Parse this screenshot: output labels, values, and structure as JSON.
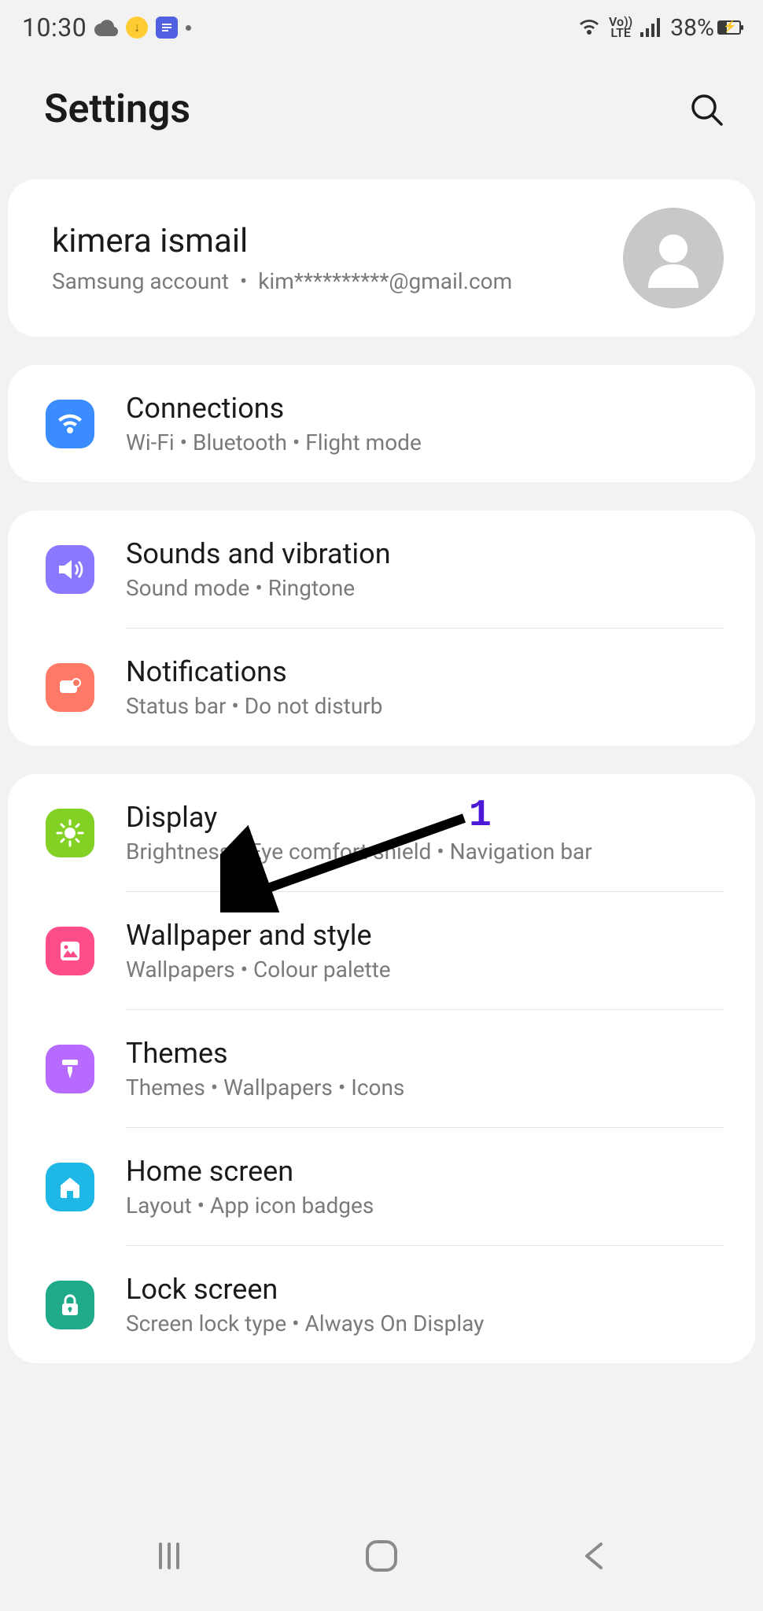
{
  "status": {
    "time": "10:30",
    "battery_percent": "38%",
    "volte": "Vo))\nLTE"
  },
  "header": {
    "title": "Settings"
  },
  "account": {
    "name": "kimera ismail",
    "provider": "Samsung account",
    "email": "kim**********@gmail.com"
  },
  "groups": [
    {
      "items": [
        {
          "icon": "wifi",
          "color": "ic-blue",
          "title": "Connections",
          "sub": "Wi-Fi  •  Bluetooth  •  Flight mode"
        }
      ]
    },
    {
      "items": [
        {
          "icon": "sound",
          "color": "ic-purple",
          "title": "Sounds and vibration",
          "sub": "Sound mode  •  Ringtone"
        },
        {
          "icon": "notif",
          "color": "ic-coral",
          "title": "Notifications",
          "sub": "Status bar  •  Do not disturb"
        }
      ]
    },
    {
      "items": [
        {
          "icon": "sun",
          "color": "ic-green",
          "title": "Display",
          "sub": "Brightness  •  Eye comfort shield  •  Navigation bar"
        },
        {
          "icon": "picture",
          "color": "ic-pink",
          "title": "Wallpaper and style",
          "sub": "Wallpapers  •  Colour palette"
        },
        {
          "icon": "brush",
          "color": "ic-violet",
          "title": "Themes",
          "sub": "Themes  •  Wallpapers  •  Icons"
        },
        {
          "icon": "home",
          "color": "ic-cyan",
          "title": "Home screen",
          "sub": "Layout  •  App icon badges"
        },
        {
          "icon": "lock",
          "color": "ic-teal",
          "title": "Lock screen",
          "sub": "Screen lock type  •  Always On Display"
        }
      ]
    }
  ],
  "annotation": {
    "label": "1"
  }
}
